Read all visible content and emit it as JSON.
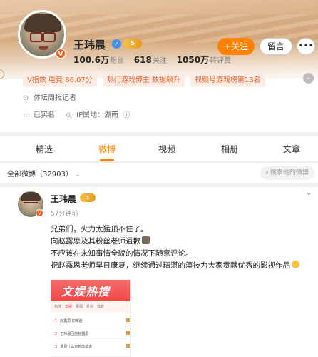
{
  "profile": {
    "name": "王玮晨",
    "verified_icon": "verified-check-icon",
    "crown_badge": "5",
    "avatar_badge": "V",
    "stats": [
      {
        "value": "100.6万",
        "label": "粉丝"
      },
      {
        "value": "618",
        "label": "关注"
      },
      {
        "value": "1050万",
        "label": "转评赞"
      }
    ],
    "follow_label": "+关注",
    "message_label": "留言",
    "more_label": "•••",
    "tags": [
      "V指数 电竞 86.07分",
      "热门游戏博主 数据飙升",
      "视频号游戏榜第13名"
    ],
    "tags_more_icon": "chevron-down-icon",
    "bio": "体坛周报记者",
    "real_name": "已实名",
    "ip": "IP属地：湖南"
  },
  "tabs": [
    "精选",
    "微博",
    "视频",
    "相册",
    "文章"
  ],
  "active_tab": "微博",
  "filter": {
    "label": "全部微博（32903）",
    "search_placeholder": "搜索他的微博"
  },
  "post": {
    "author": "王玮晨",
    "crown_badge": "5",
    "avatar_badge": "V",
    "time": "57分钟前",
    "lines": [
      "兄弟们，火力太猛顶不住了。",
      "向赵露思及其粉丝老师道歉",
      "不应该在未知事情全貌的情况下随意评论。",
      "祝赵露思老师早日康复，继续通过精湛的演技为大家贡献优秀的影视作品"
    ],
    "image": {
      "title": "文娱热搜",
      "tabs": [
        "热搜",
        "文娱",
        "要闻",
        "社会",
        "体育"
      ],
      "active_tab": "文娱",
      "rows": [
        {
          "rank": "1",
          "text": "赵露思 抑郁症"
        },
        {
          "rank": "2",
          "text": "王玮晨回应赵露思"
        },
        {
          "rank": "3",
          "text": "遇见什么只管向前走"
        }
      ]
    }
  },
  "colors": {
    "accent": "#ff8200",
    "tag_bg": "#fdece6",
    "tag_text": "#e0632a",
    "verified": "#3b8ff0"
  }
}
